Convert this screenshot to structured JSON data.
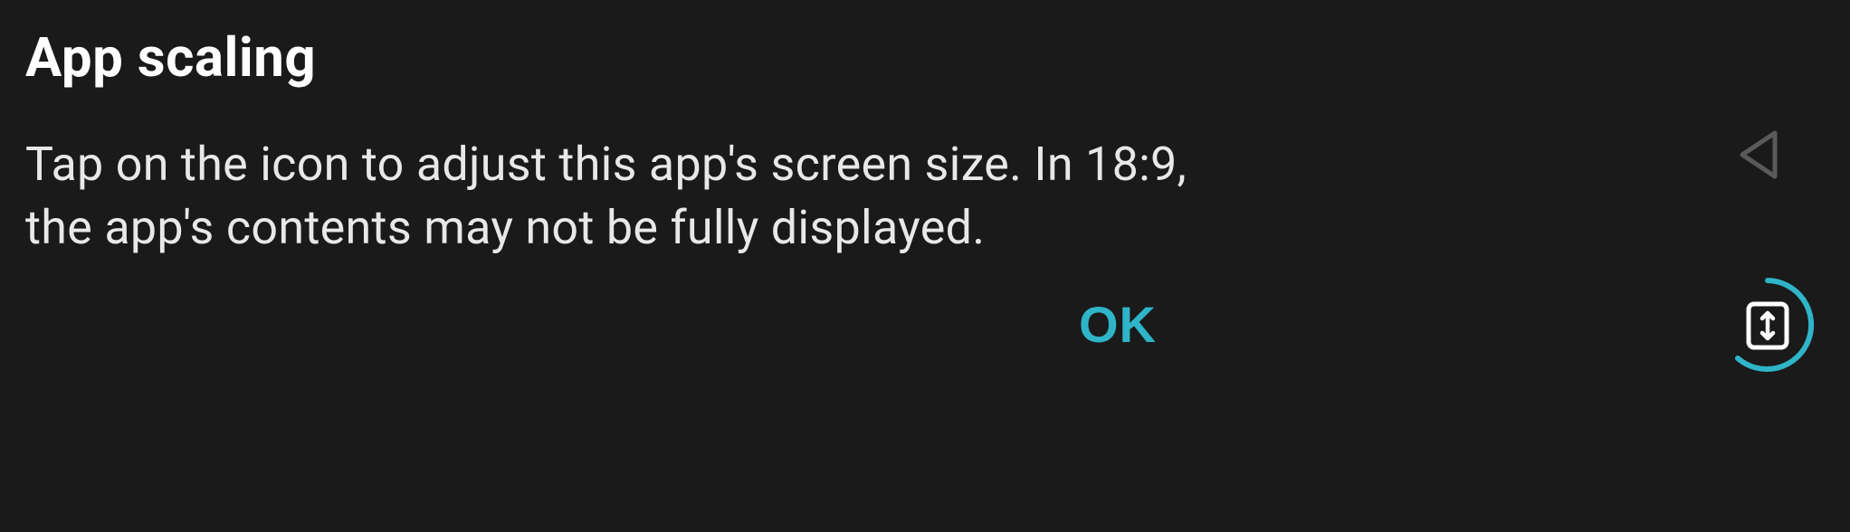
{
  "dialog": {
    "title": "App scaling",
    "description": "Tap on the icon to adjust this app's screen size. In 18:9, the app's contents may not be fully displayed.",
    "ok_label": "OK"
  },
  "colors": {
    "accent": "#2fb4c8",
    "background": "#1a1a1a",
    "text_primary": "#ffffff",
    "text_secondary": "#e8e8e8",
    "icon_outline": "#666666"
  }
}
